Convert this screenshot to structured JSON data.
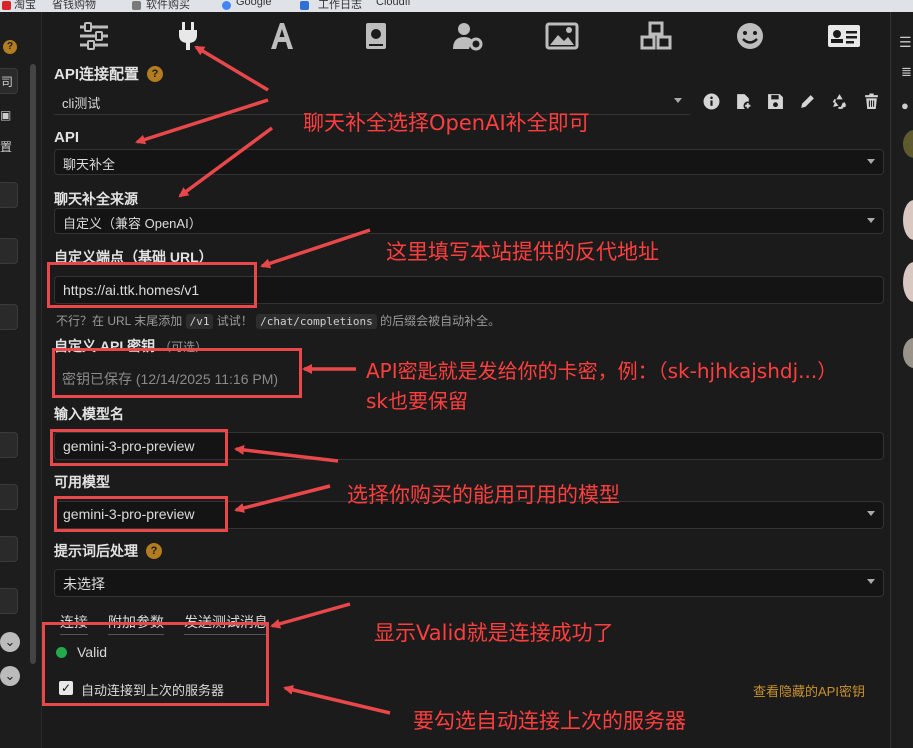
{
  "browser": {
    "bookmarks": [
      "淘宝",
      "省钱购物",
      "软件购买",
      "Google",
      "工作日志",
      "Cloudfl"
    ]
  },
  "top_tabs": [
    {
      "icon": "sliders-icon"
    },
    {
      "icon": "plug-icon",
      "active": true
    },
    {
      "icon": "font-icon"
    },
    {
      "icon": "book-icon"
    },
    {
      "icon": "user-cog-icon"
    },
    {
      "icon": "image-icon"
    },
    {
      "icon": "cubes-icon"
    },
    {
      "icon": "smile-icon"
    },
    {
      "icon": "id-card-icon"
    }
  ],
  "api_config": {
    "title": "API连接配置",
    "help": "?",
    "profile": "cli测试",
    "actions": [
      "info-icon",
      "add-file-icon",
      "save-icon",
      "pencil-icon",
      "recycle-icon",
      "trash-icon"
    ]
  },
  "api": {
    "label": "API",
    "value": "聊天补全"
  },
  "chat_source": {
    "label": "聊天补全来源",
    "value": "自定义（兼容 OpenAI）"
  },
  "endpoint": {
    "label": "自定义端点（基础 URL）",
    "value": "https://ai.ttk.homes/v1",
    "hint_prefix": "不行？在 URL 末尾添加",
    "hint_code1": "/v1",
    "hint_mid": "试试！",
    "hint_code2": "/chat/completions",
    "hint_suffix": "的后缀会被自动补全。"
  },
  "api_key": {
    "label": "自定义 API 密钥",
    "optional": "（可选）",
    "placeholder": "密钥已保存 (12/14/2025 11:16 PM)"
  },
  "model_input": {
    "label": "输入模型名",
    "value": "gemini-3-pro-preview"
  },
  "available_models": {
    "label": "可用模型",
    "value": "gemini-3-pro-preview"
  },
  "prompt_post": {
    "label": "提示词后处理",
    "help": "?",
    "value": "未选择"
  },
  "sub_tabs": [
    "连接",
    "附加参数",
    "发送测试消息"
  ],
  "status": {
    "dot_color": "#22a94b",
    "text": "Valid"
  },
  "auto_connect": {
    "checked": true,
    "label": "自动连接到上次的服务器"
  },
  "hidden_key_link": "查看隐藏的API密钥",
  "annotations": {
    "a1": "聊天补全选择OpenAI补全即可",
    "a2": "这里填写本站提供的反代地址",
    "a3_line1": "API密匙就是发给你的卡密，例：（sk-hjhkajshdj...）",
    "a3_line2": "sk也要保留",
    "a4": "选择你购买的能用可用的模型",
    "a5": "显示Valid就是连接成功了",
    "a6": "要勾选自动连接上次的服务器"
  },
  "left_strip": {
    "edge_texts": [
      "司",
      "置"
    ]
  }
}
